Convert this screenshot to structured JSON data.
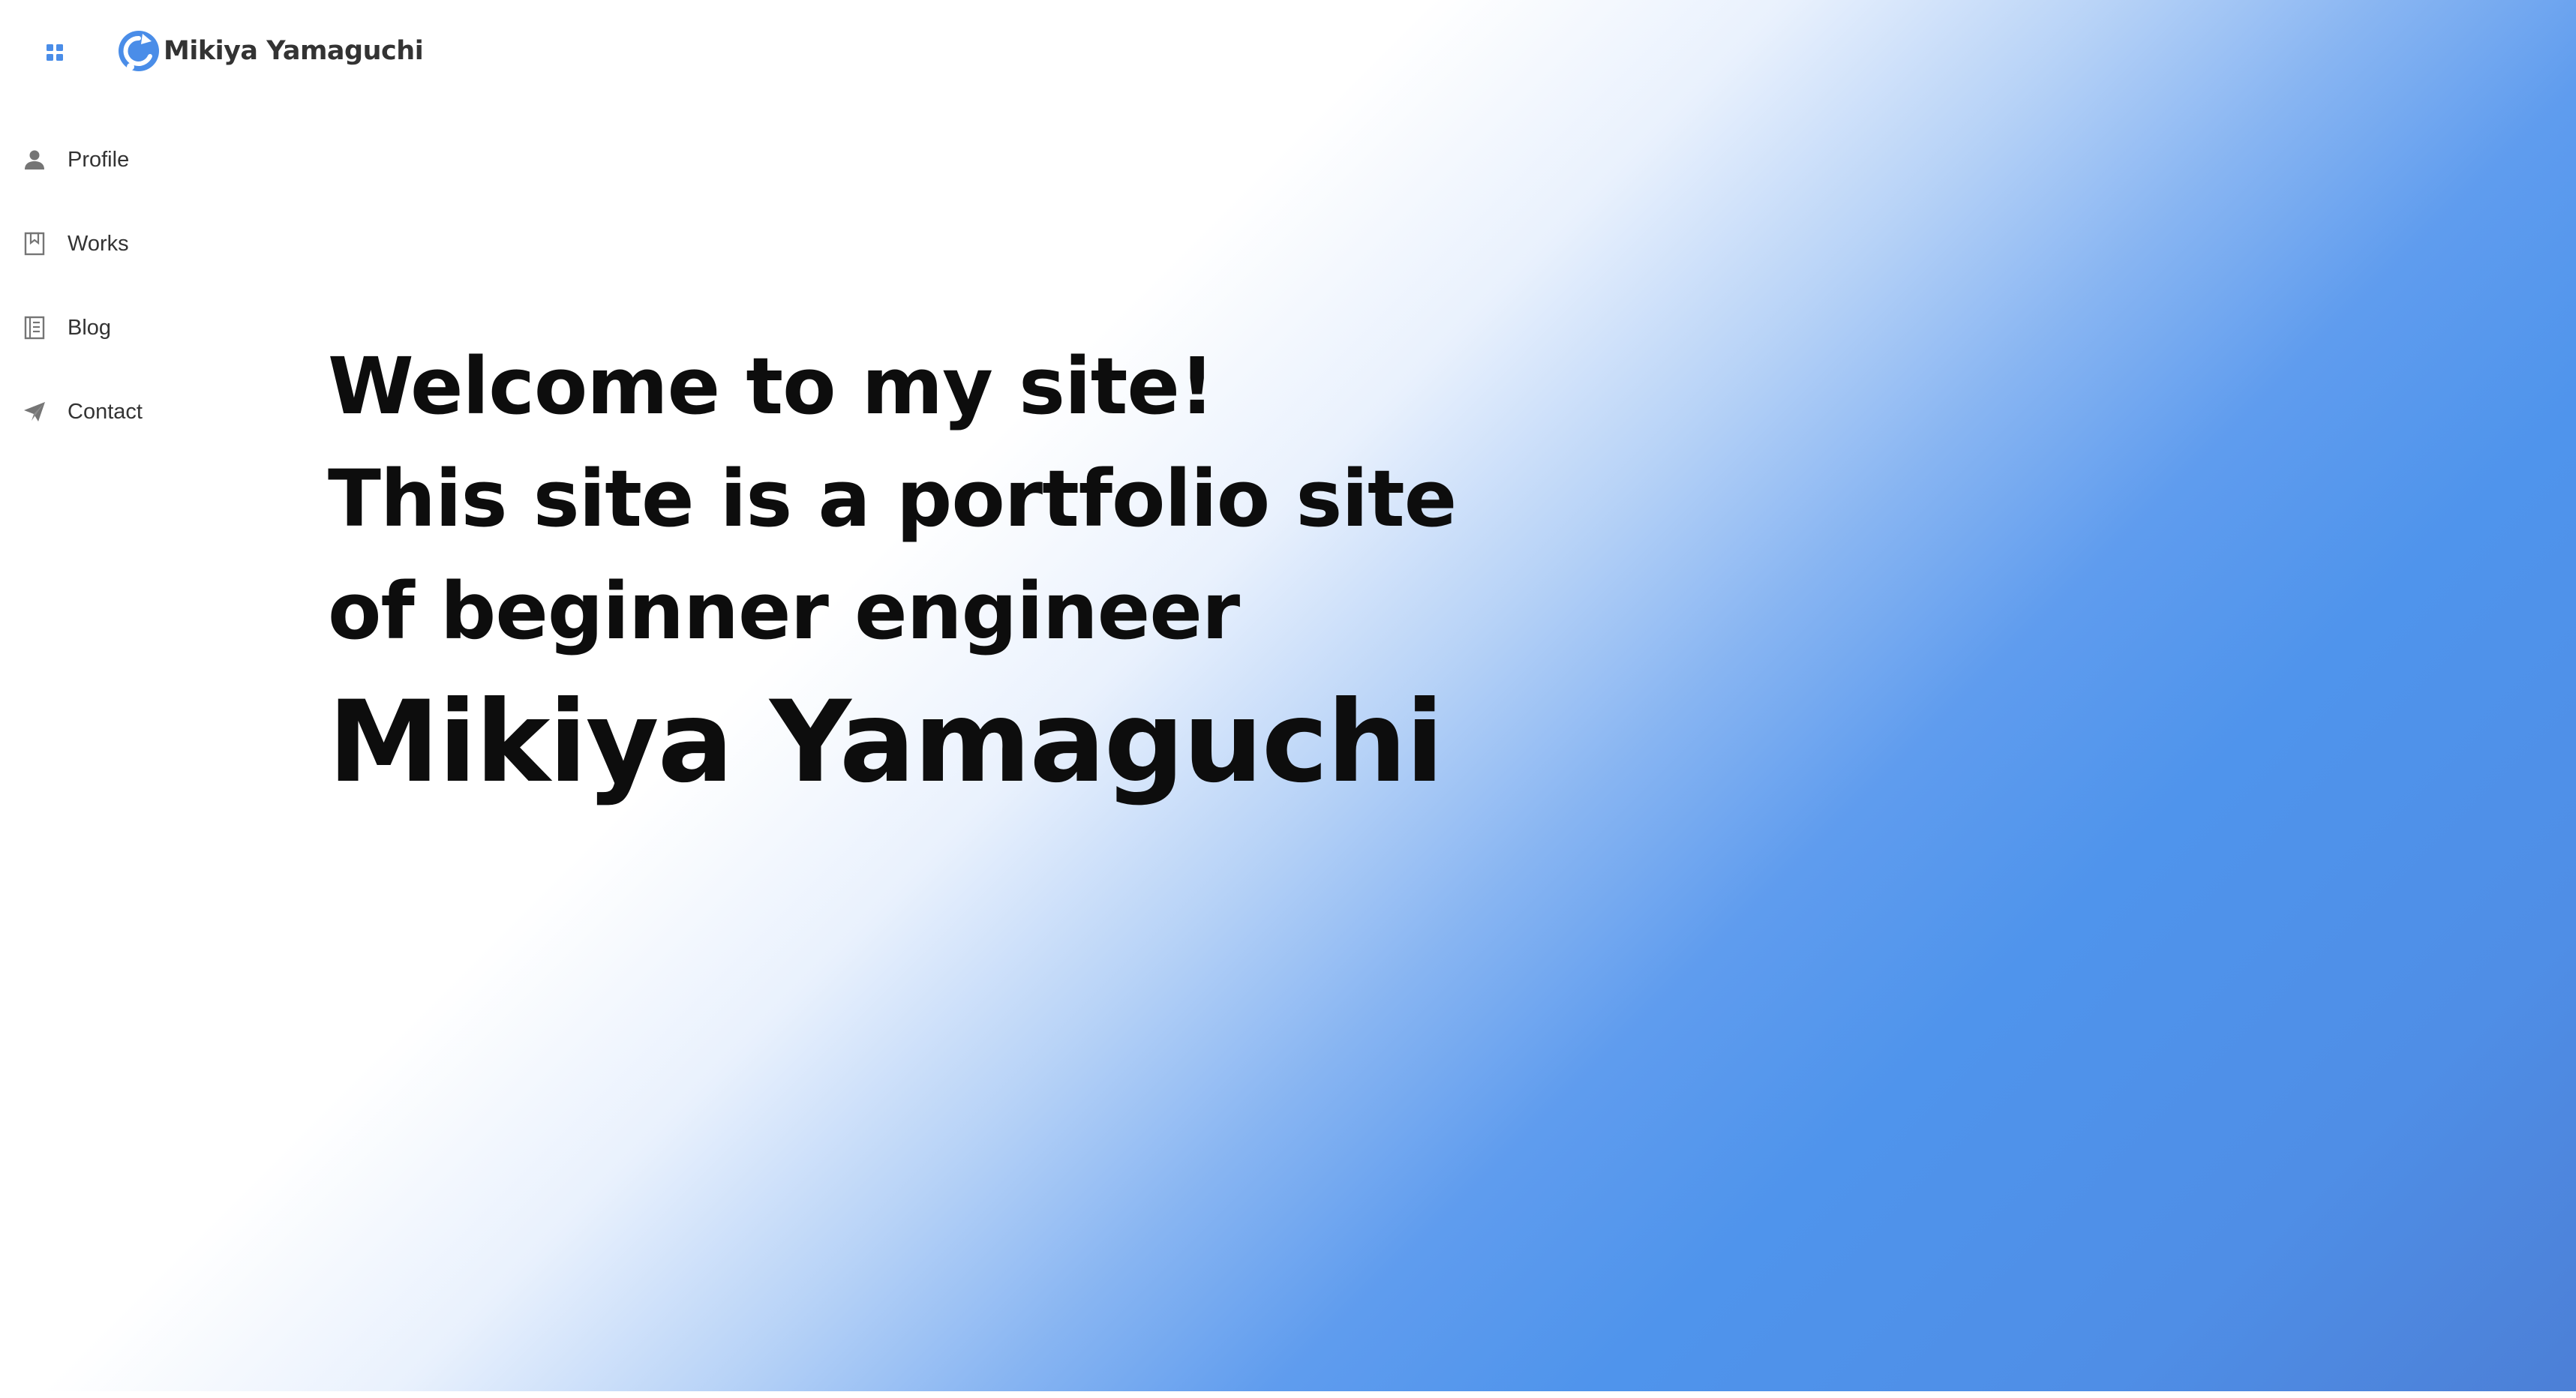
{
  "header": {
    "brand_name": "Mikiya Yamaguchi",
    "apps_icon": "apps-grid-icon",
    "logo_icon": "circular-arrow-logo-icon"
  },
  "sidebar": {
    "items": [
      {
        "label": "Profile",
        "icon": "person-icon"
      },
      {
        "label": "Works",
        "icon": "bookmark-book-icon"
      },
      {
        "label": "Blog",
        "icon": "document-icon"
      },
      {
        "label": "Contact",
        "icon": "paper-plane-icon"
      }
    ]
  },
  "hero": {
    "lines": [
      "Welcome to my site!",
      "This site is a portfolio site",
      "of beginner engineer"
    ],
    "name": "Mikiya Yamaguchi"
  },
  "colors": {
    "accent": "#4f94ec",
    "icon_blue": "#4a8de8",
    "icon_gray": "#757575",
    "text_dark": "#0d0d0d"
  }
}
